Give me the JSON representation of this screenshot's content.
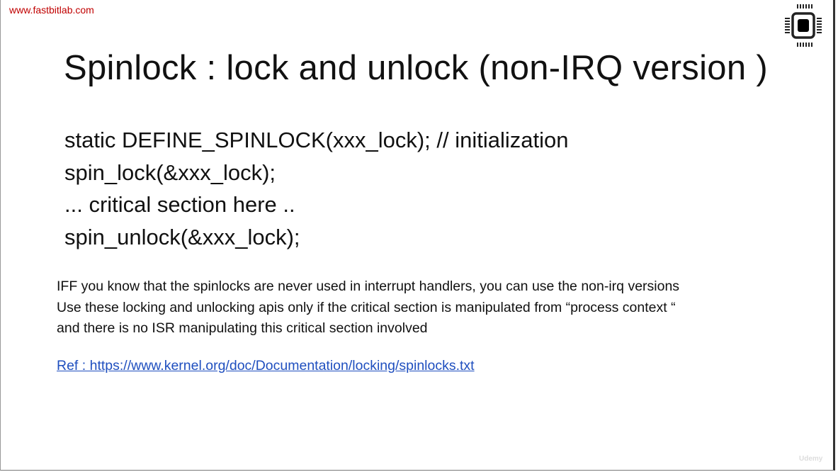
{
  "site_url": "www.fastbitlab.com",
  "title": "Spinlock : lock and unlock (non-IRQ version )",
  "code_lines": [
    "static DEFINE_SPINLOCK(xxx_lock); // initialization",
    "spin_lock(&xxx_lock);",
    "... critical section here ..",
    "spin_unlock(&xxx_lock);"
  ],
  "paragraph_lines": [
    "IFF you know that the spinlocks are never used in interrupt handlers, you can use the non-irq versions",
    "Use these locking and unlocking apis only if the critical section is manipulated from “process context “",
    "and there is no ISR manipulating this critical section involved"
  ],
  "ref_link": "Ref : https://www.kernel.org/doc/Documentation/locking/spinlocks.txt",
  "watermark": "Udemy",
  "icons": {
    "logo": "microchip-icon"
  }
}
